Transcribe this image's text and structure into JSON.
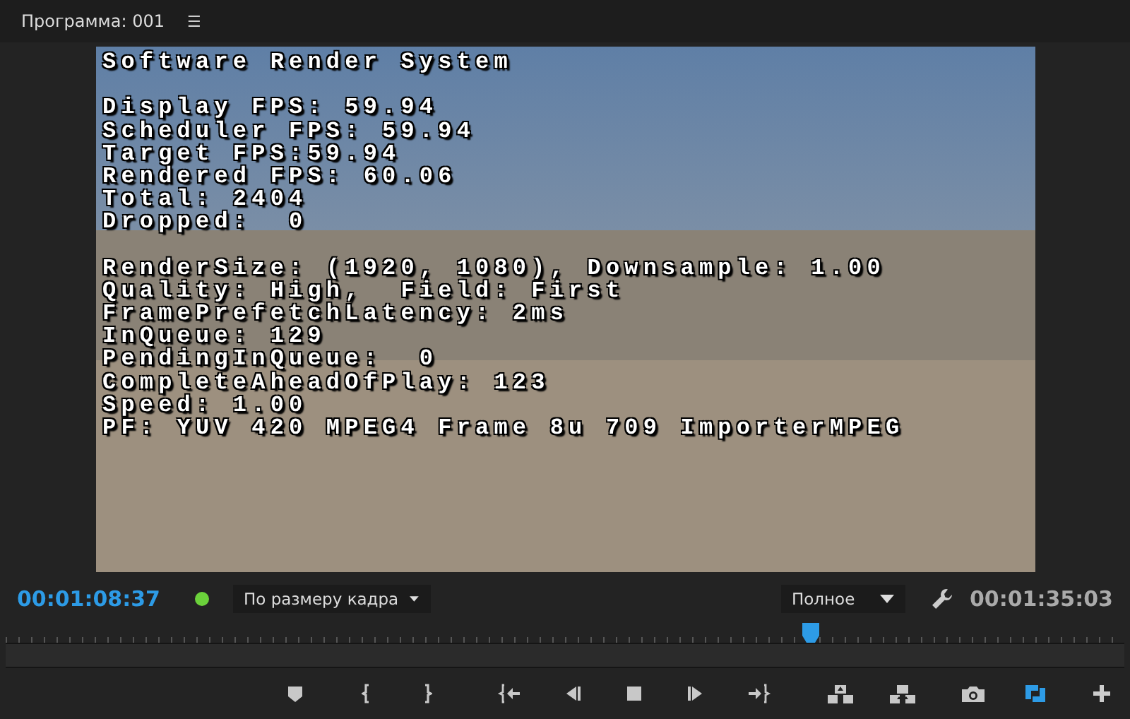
{
  "panel": {
    "title": "Программа: 001",
    "menu_icon": "☰"
  },
  "overlay": {
    "groups": [
      [
        "Software Render System"
      ],
      [
        "Display FPS: 59.94",
        "Scheduler FPS: 59.94",
        "Target FPS:59.94",
        "Rendered FPS: 60.06",
        "Total: 2404",
        "Dropped:  0"
      ],
      [
        "RenderSize: (1920, 1080), Downsample: 1.00",
        "Quality: High,  Field: First",
        "FramePrefetchLatency: 2ms",
        "InQueue: 129",
        "PendingInQueue:  0",
        "CompleteAheadOfPlay: 123",
        "Speed: 1.00",
        "PF: YUV 420 MPEG4 Frame 8u 709 ImporterMPEG"
      ]
    ]
  },
  "status": {
    "current_time": "00:01:08:37",
    "rendered": true,
    "zoom": "По размеру кадра",
    "resolution": "Полное",
    "duration": "00:01:35:03"
  },
  "timeline": {
    "level": 0.72
  },
  "transport": [
    {
      "kind": "marker",
      "active": false
    },
    {
      "kind": "in",
      "active": false
    },
    {
      "kind": "out",
      "active": false
    },
    {
      "kind": "goto-in",
      "active": false
    },
    {
      "kind": "step-back",
      "active": false
    },
    {
      "kind": "stop",
      "active": false
    },
    {
      "kind": "step-forward",
      "active": false
    },
    {
      "kind": "goto-out",
      "active": false
    },
    {
      "kind": "lift",
      "active": false
    },
    {
      "kind": "extract",
      "active": false
    },
    {
      "kind": "camera",
      "active": false
    },
    {
      "kind": "loop",
      "active": true
    }
  ]
}
